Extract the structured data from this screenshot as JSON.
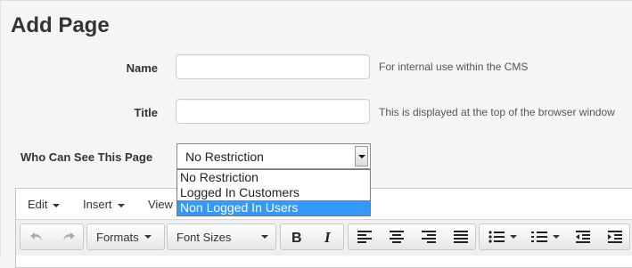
{
  "page": {
    "title": "Add Page"
  },
  "form": {
    "name": {
      "label": "Name",
      "value": "",
      "help": "For internal use within the CMS"
    },
    "title": {
      "label": "Title",
      "value": "",
      "help": "This is displayed at the top of the browser window"
    },
    "visibility": {
      "label": "Who Can See This Page",
      "selected": "No Restriction",
      "options": [
        "No Restriction",
        "Logged In Customers",
        "Non Logged In Users"
      ],
      "highlighted": "Non Logged In Users"
    }
  },
  "editor": {
    "menubar": {
      "edit": "Edit",
      "insert": "Insert",
      "view": "View"
    },
    "toolbar": {
      "undo_icon": "undo-icon",
      "redo_icon": "redo-icon",
      "formats": "Formats",
      "font_sizes": "Font Sizes",
      "bold_icon": "bold-icon",
      "italic_icon": "italic-icon",
      "align_icons": [
        "align-left-icon",
        "align-center-icon",
        "align-right-icon",
        "align-justify-icon"
      ],
      "list_icons": [
        "bullet-list-icon",
        "numbered-list-icon"
      ],
      "indent_icons": [
        "outdent-icon",
        "indent-icon"
      ]
    }
  }
}
